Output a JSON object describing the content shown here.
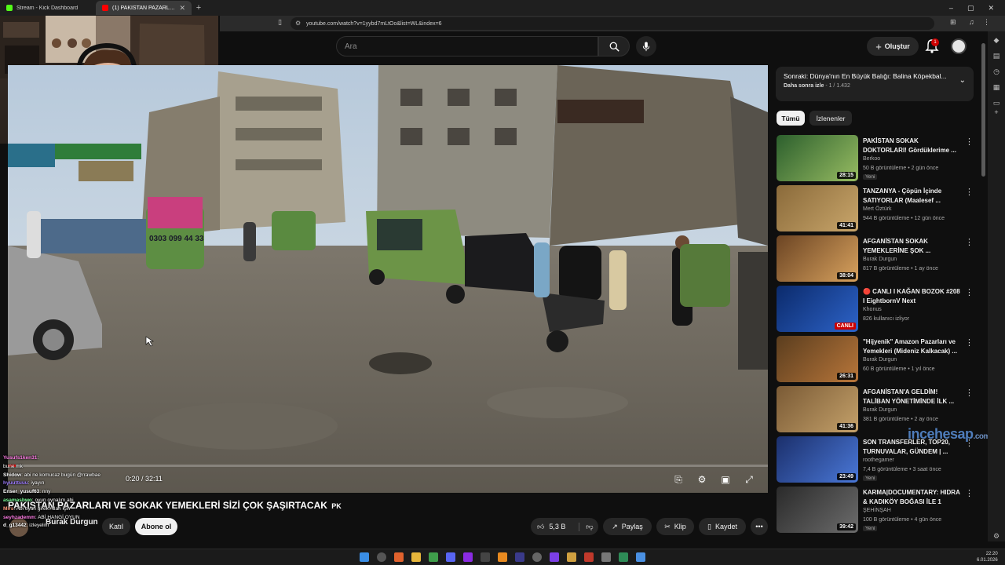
{
  "browser": {
    "tabs": [
      {
        "label": "Stream - Kick Dashboard",
        "favicon_color": "#53fc18",
        "active": false
      },
      {
        "label": "(1) PAKİSTAN PAZARLARI VE SOKAK",
        "favicon_color": "#ff0000",
        "active": true
      }
    ],
    "url": "youtube.com/watch?v=1yybd7mLtOo&list=WL&index=6"
  },
  "header": {
    "search_placeholder": "Ara",
    "create_label": "Oluştur",
    "notification_count": "1"
  },
  "video": {
    "time": "0:20 / 32:11",
    "progress": 0.0104,
    "overlay_sign": "0303 099 44 33",
    "title": "PAKİSTAN PAZARLARI VE SOKAK YEMEKLERİ SİZİ ÇOK ŞAŞIRTACAK",
    "title_suffix": "PK",
    "channel": "Burak Durgun",
    "join_label": "Katıl",
    "subscribe_label": "Abone ol",
    "likes": "5,3 B",
    "share_label": "Paylaş",
    "clip_label": "Klip",
    "save_label": "Kaydet"
  },
  "chat": [
    {
      "user": "Yusufs1ken31",
      "text": ":",
      "color": "#ff7de6"
    },
    {
      "user": "",
      "text": "bune mk",
      "color": "#9fc0ff"
    },
    {
      "user": "Shidow",
      "text": ": abi ne komucaz bugün @rrawbae",
      "color": "#ffffff"
    },
    {
      "user": "hyuuttuuu",
      "text": ": iyayın",
      "color": "#9f7dff"
    },
    {
      "user": "Enser_yusuf63",
      "text": ": nny",
      "color": "#ffffff"
    },
    {
      "user": "asamasbwo",
      "text": ": oyun oynalım abi",
      "color": "#7dff9a"
    },
    {
      "user": "Mirs",
      "text": ": Abi oyun girek Allah için",
      "color": "#ff9a7d"
    },
    {
      "user": "seyhzademm",
      "text": ": ABİ HANGİ OYUN",
      "color": "#ff7de6"
    },
    {
      "user": "d_g13442",
      "text": ": izleyelim",
      "color": "#ffffff"
    }
  ],
  "sidebar": {
    "up_next_title": "Sonraki: Dünya'nın En Büyük Balığı: Balina Köpekbal...",
    "up_next_sub": "Daha sonra izle",
    "up_next_index": "1 / 1.432",
    "chips": [
      "Tümü",
      "İzlenenler"
    ],
    "items": [
      {
        "title": "PAKİSTAN SOKAK DOKTORLARI! Gördüklerime ...",
        "channel": "Berkoo",
        "meta": "50 B görüntüleme • 2 gün önce",
        "duration": "28:15",
        "badge": "Yeni",
        "thumb": [
          "#2c5f2d",
          "#97bc62"
        ]
      },
      {
        "title": "TANZANYA - Çöpün İçinde SATIYORLAR (Maalesef ...",
        "channel": "Mert Öztürk",
        "meta": "944 B görüntüleme • 12 gün önce",
        "duration": "41:41",
        "badge": "",
        "thumb": [
          "#8a6a3a",
          "#c9a66b"
        ]
      },
      {
        "title": "AFGANİSTAN SOKAK YEMEKLERİNE ŞOK ...",
        "channel": "Burak Durgun",
        "meta": "817 B görüntüleme • 1 ay önce",
        "duration": "38:04",
        "badge": "",
        "thumb": [
          "#6b4423",
          "#d8a25e"
        ]
      },
      {
        "title": "🔴 CANLI I KAĞAN BOZOK #208 I EightbornV Next",
        "channel": "Khonus",
        "meta": "826 kullanıcı izliyor",
        "duration": "CANLI",
        "badge": "",
        "thumb": [
          "#0b2a6b",
          "#2d63c8"
        ]
      },
      {
        "title": "\"Hijyenik\" Amazon Pazarları ve Yemekleri (Mideniz Kalkacak) ...",
        "channel": "Burak Durgun",
        "meta": "60 B görüntüleme • 1 yıl önce",
        "duration": "26:31",
        "badge": "",
        "thumb": [
          "#5a3d1e",
          "#b8763a"
        ]
      },
      {
        "title": "AFGANİSTAN'A GELDİM! TALİBAN YÖNETİMİNDE İLK ...",
        "channel": "Burak Durgun",
        "meta": "381 B görüntüleme • 2 ay önce",
        "duration": "41:36",
        "badge": "",
        "thumb": [
          "#7a5a35",
          "#c4a16a"
        ]
      },
      {
        "title": "SON TRANSFERLER, TOP20, TURNUVALAR, GÜNDEM | ...",
        "channel": "roothegamer",
        "meta": "7,4 B görüntüleme • 3 saat önce",
        "duration": "23:49",
        "badge": "Yeni",
        "thumb": [
          "#1b2f6b",
          "#4a78d8"
        ]
      },
      {
        "title": "KARMA|DOCUMENTARY: HIDRA & KADIKÖY BOĞASI İLE 1 GÜN...",
        "channel": "ŞEHİNŞAH",
        "meta": "100 B görüntüleme • 4 gün önce",
        "duration": "39:42",
        "badge": "Yeni",
        "thumb": [
          "#2a2a2a",
          "#6c6c6c"
        ]
      }
    ]
  },
  "watermark": {
    "brand": "incehesap",
    "domain": ".com"
  },
  "clock": {
    "time": "22:20",
    "date": "6.01.2026"
  }
}
